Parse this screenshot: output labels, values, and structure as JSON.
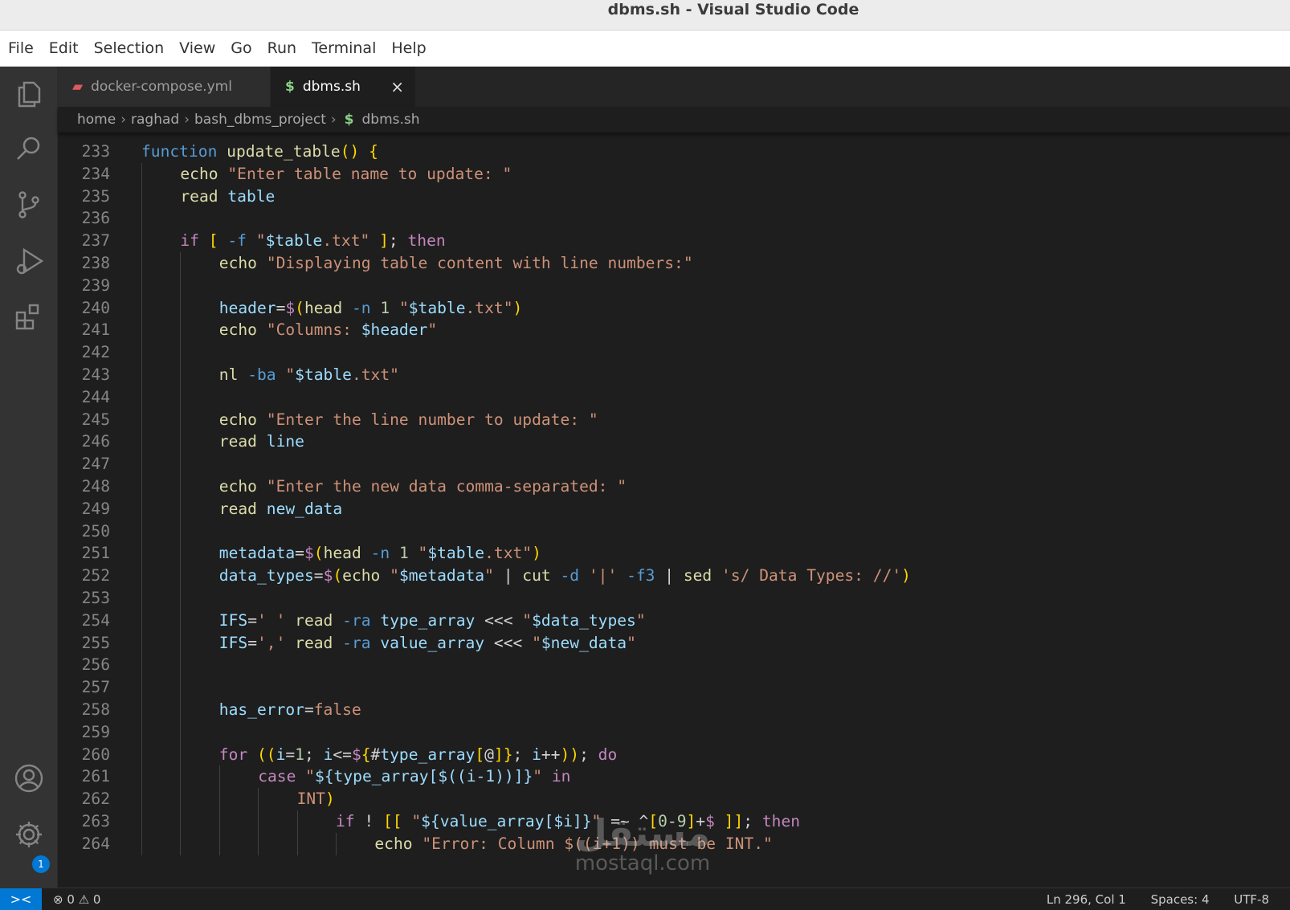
{
  "window": {
    "title": "dbms.sh - Visual Studio Code"
  },
  "menu": [
    "File",
    "Edit",
    "Selection",
    "View",
    "Go",
    "Run",
    "Terminal",
    "Help"
  ],
  "activity_bar": {
    "icons": [
      "explorer-icon",
      "search-icon",
      "source-control-icon",
      "run-debug-icon",
      "extensions-icon",
      "account-icon",
      "settings-gear-icon"
    ],
    "settings_badge": "1"
  },
  "tabs": [
    {
      "label": "docker-compose.yml",
      "icon": "docker-icon",
      "active": false
    },
    {
      "label": "dbms.sh",
      "icon": "$",
      "active": true,
      "close": "×"
    }
  ],
  "breadcrumb": {
    "parts": [
      "home",
      "raghad",
      "bash_dbms_project"
    ],
    "file_icon": "$",
    "file": "dbms.sh"
  },
  "editor": {
    "lines": [
      {
        "n": "233",
        "indent": 0,
        "code": "function update_table() {"
      },
      {
        "n": "234",
        "indent": 1,
        "code": "echo \"Enter table name to update: \""
      },
      {
        "n": "235",
        "indent": 1,
        "code": "read table"
      },
      {
        "n": "236",
        "indent": 1,
        "code": ""
      },
      {
        "n": "237",
        "indent": 1,
        "code": "if [ -f \"$table.txt\" ]; then"
      },
      {
        "n": "238",
        "indent": 2,
        "code": "echo \"Displaying table content with line numbers:\""
      },
      {
        "n": "239",
        "indent": 2,
        "code": ""
      },
      {
        "n": "240",
        "indent": 2,
        "code": "header=$(head -n 1 \"$table.txt\")"
      },
      {
        "n": "241",
        "indent": 2,
        "code": "echo \"Columns: $header\""
      },
      {
        "n": "242",
        "indent": 2,
        "code": ""
      },
      {
        "n": "243",
        "indent": 2,
        "code": "nl -ba \"$table.txt\""
      },
      {
        "n": "244",
        "indent": 2,
        "code": ""
      },
      {
        "n": "245",
        "indent": 2,
        "code": "echo \"Enter the line number to update: \""
      },
      {
        "n": "246",
        "indent": 2,
        "code": "read line"
      },
      {
        "n": "247",
        "indent": 2,
        "code": ""
      },
      {
        "n": "248",
        "indent": 2,
        "code": "echo \"Enter the new data comma-separated: \""
      },
      {
        "n": "249",
        "indent": 2,
        "code": "read new_data"
      },
      {
        "n": "250",
        "indent": 2,
        "code": ""
      },
      {
        "n": "251",
        "indent": 2,
        "code": "metadata=$(head -n 1 \"$table.txt\")"
      },
      {
        "n": "252",
        "indent": 2,
        "code": "data_types=$(echo \"$metadata\" | cut -d '|' -f3 | sed 's/ Data Types: //')"
      },
      {
        "n": "253",
        "indent": 2,
        "code": ""
      },
      {
        "n": "254",
        "indent": 2,
        "code": "IFS=' ' read -ra type_array <<< \"$data_types\""
      },
      {
        "n": "255",
        "indent": 2,
        "code": "IFS=',' read -ra value_array <<< \"$new_data\""
      },
      {
        "n": "256",
        "indent": 2,
        "code": ""
      },
      {
        "n": "257",
        "indent": 2,
        "code": ""
      },
      {
        "n": "258",
        "indent": 2,
        "code": "has_error=false"
      },
      {
        "n": "259",
        "indent": 2,
        "code": ""
      },
      {
        "n": "260",
        "indent": 2,
        "code": "for ((i=1; i<=${#type_array[@]}; i++)); do"
      },
      {
        "n": "261",
        "indent": 3,
        "code": "case \"${type_array[$((i-1))]}\" in"
      },
      {
        "n": "262",
        "indent": 4,
        "code": "INT)"
      },
      {
        "n": "263",
        "indent": 5,
        "code": "if ! [[ \"${value_array[$i]}\" =~ ^[0-9]+$ ]]; then"
      },
      {
        "n": "264",
        "indent": 6,
        "code": "echo \"Error: Column $((i+1)) must be INT.\""
      }
    ]
  },
  "status": {
    "remote_icon": "><",
    "errors": "0",
    "warnings": "0",
    "cursor": "Ln 296, Col 1",
    "spaces": "Spaces: 4",
    "encoding": "UTF-8"
  },
  "watermark": {
    "arabic": "مستقل",
    "latin": "mostaql.com"
  }
}
